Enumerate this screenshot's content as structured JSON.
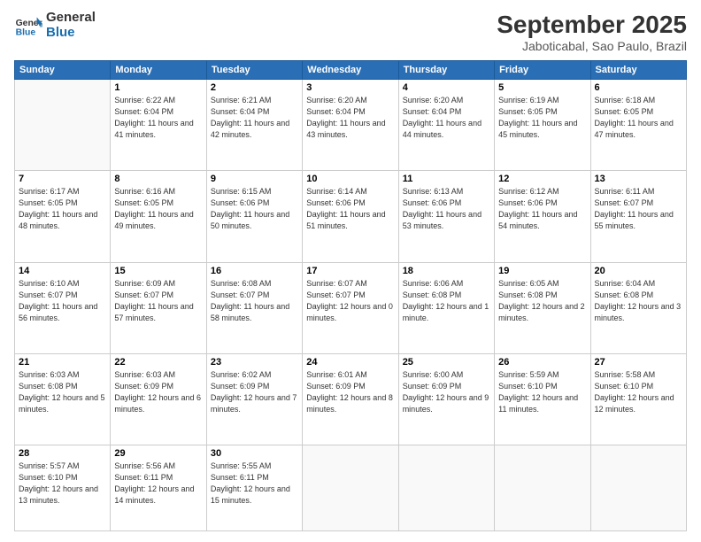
{
  "header": {
    "logo_line1": "General",
    "logo_line2": "Blue",
    "month": "September 2025",
    "location": "Jaboticabal, Sao Paulo, Brazil"
  },
  "weekdays": [
    "Sunday",
    "Monday",
    "Tuesday",
    "Wednesday",
    "Thursday",
    "Friday",
    "Saturday"
  ],
  "weeks": [
    [
      {
        "day": "",
        "sunrise": "",
        "sunset": "",
        "daylight": ""
      },
      {
        "day": "1",
        "sunrise": "6:22 AM",
        "sunset": "6:04 PM",
        "daylight": "11 hours and 41 minutes."
      },
      {
        "day": "2",
        "sunrise": "6:21 AM",
        "sunset": "6:04 PM",
        "daylight": "11 hours and 42 minutes."
      },
      {
        "day": "3",
        "sunrise": "6:20 AM",
        "sunset": "6:04 PM",
        "daylight": "11 hours and 43 minutes."
      },
      {
        "day": "4",
        "sunrise": "6:20 AM",
        "sunset": "6:04 PM",
        "daylight": "11 hours and 44 minutes."
      },
      {
        "day": "5",
        "sunrise": "6:19 AM",
        "sunset": "6:05 PM",
        "daylight": "11 hours and 45 minutes."
      },
      {
        "day": "6",
        "sunrise": "6:18 AM",
        "sunset": "6:05 PM",
        "daylight": "11 hours and 47 minutes."
      }
    ],
    [
      {
        "day": "7",
        "sunrise": "6:17 AM",
        "sunset": "6:05 PM",
        "daylight": "11 hours and 48 minutes."
      },
      {
        "day": "8",
        "sunrise": "6:16 AM",
        "sunset": "6:05 PM",
        "daylight": "11 hours and 49 minutes."
      },
      {
        "day": "9",
        "sunrise": "6:15 AM",
        "sunset": "6:06 PM",
        "daylight": "11 hours and 50 minutes."
      },
      {
        "day": "10",
        "sunrise": "6:14 AM",
        "sunset": "6:06 PM",
        "daylight": "11 hours and 51 minutes."
      },
      {
        "day": "11",
        "sunrise": "6:13 AM",
        "sunset": "6:06 PM",
        "daylight": "11 hours and 53 minutes."
      },
      {
        "day": "12",
        "sunrise": "6:12 AM",
        "sunset": "6:06 PM",
        "daylight": "11 hours and 54 minutes."
      },
      {
        "day": "13",
        "sunrise": "6:11 AM",
        "sunset": "6:07 PM",
        "daylight": "11 hours and 55 minutes."
      }
    ],
    [
      {
        "day": "14",
        "sunrise": "6:10 AM",
        "sunset": "6:07 PM",
        "daylight": "11 hours and 56 minutes."
      },
      {
        "day": "15",
        "sunrise": "6:09 AM",
        "sunset": "6:07 PM",
        "daylight": "11 hours and 57 minutes."
      },
      {
        "day": "16",
        "sunrise": "6:08 AM",
        "sunset": "6:07 PM",
        "daylight": "11 hours and 58 minutes."
      },
      {
        "day": "17",
        "sunrise": "6:07 AM",
        "sunset": "6:07 PM",
        "daylight": "12 hours and 0 minutes."
      },
      {
        "day": "18",
        "sunrise": "6:06 AM",
        "sunset": "6:08 PM",
        "daylight": "12 hours and 1 minute."
      },
      {
        "day": "19",
        "sunrise": "6:05 AM",
        "sunset": "6:08 PM",
        "daylight": "12 hours and 2 minutes."
      },
      {
        "day": "20",
        "sunrise": "6:04 AM",
        "sunset": "6:08 PM",
        "daylight": "12 hours and 3 minutes."
      }
    ],
    [
      {
        "day": "21",
        "sunrise": "6:03 AM",
        "sunset": "6:08 PM",
        "daylight": "12 hours and 5 minutes."
      },
      {
        "day": "22",
        "sunrise": "6:03 AM",
        "sunset": "6:09 PM",
        "daylight": "12 hours and 6 minutes."
      },
      {
        "day": "23",
        "sunrise": "6:02 AM",
        "sunset": "6:09 PM",
        "daylight": "12 hours and 7 minutes."
      },
      {
        "day": "24",
        "sunrise": "6:01 AM",
        "sunset": "6:09 PM",
        "daylight": "12 hours and 8 minutes."
      },
      {
        "day": "25",
        "sunrise": "6:00 AM",
        "sunset": "6:09 PM",
        "daylight": "12 hours and 9 minutes."
      },
      {
        "day": "26",
        "sunrise": "5:59 AM",
        "sunset": "6:10 PM",
        "daylight": "12 hours and 11 minutes."
      },
      {
        "day": "27",
        "sunrise": "5:58 AM",
        "sunset": "6:10 PM",
        "daylight": "12 hours and 12 minutes."
      }
    ],
    [
      {
        "day": "28",
        "sunrise": "5:57 AM",
        "sunset": "6:10 PM",
        "daylight": "12 hours and 13 minutes."
      },
      {
        "day": "29",
        "sunrise": "5:56 AM",
        "sunset": "6:11 PM",
        "daylight": "12 hours and 14 minutes."
      },
      {
        "day": "30",
        "sunrise": "5:55 AM",
        "sunset": "6:11 PM",
        "daylight": "12 hours and 15 minutes."
      },
      {
        "day": "",
        "sunrise": "",
        "sunset": "",
        "daylight": ""
      },
      {
        "day": "",
        "sunrise": "",
        "sunset": "",
        "daylight": ""
      },
      {
        "day": "",
        "sunrise": "",
        "sunset": "",
        "daylight": ""
      },
      {
        "day": "",
        "sunrise": "",
        "sunset": "",
        "daylight": ""
      }
    ]
  ]
}
